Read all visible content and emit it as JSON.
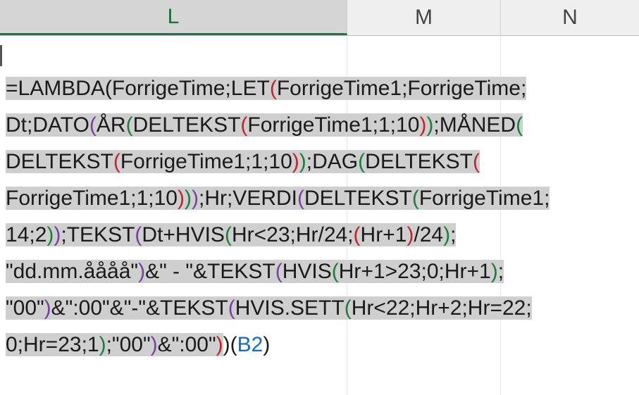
{
  "columns": [
    {
      "label": "L",
      "active": true
    },
    {
      "label": "M",
      "active": false
    },
    {
      "label": "N",
      "active": false
    }
  ],
  "formula": {
    "cell_reference_arg": "B2",
    "lines": [
      [
        {
          "t": "=LAMBDA(ForrigeTime;LET",
          "c": "text"
        },
        {
          "t": "(",
          "c": "red"
        },
        {
          "t": "ForrigeTime1;ForrigeTime;",
          "c": "text"
        }
      ],
      [
        {
          "t": "Dt;DATO",
          "c": "text"
        },
        {
          "t": "(",
          "c": "purple"
        },
        {
          "t": "ÅR",
          "c": "text"
        },
        {
          "t": "(",
          "c": "green"
        },
        {
          "t": "DELTEKST",
          "c": "text"
        },
        {
          "t": "(",
          "c": "red"
        },
        {
          "t": "ForrigeTime1;1;10",
          "c": "text"
        },
        {
          "t": ")",
          "c": "red"
        },
        {
          "t": ")",
          "c": "green"
        },
        {
          "t": ";MÅNED",
          "c": "text"
        },
        {
          "t": "(",
          "c": "green"
        }
      ],
      [
        {
          "t": "DELTEKST",
          "c": "text"
        },
        {
          "t": "(",
          "c": "red"
        },
        {
          "t": "ForrigeTime1;1;10",
          "c": "text"
        },
        {
          "t": ")",
          "c": "red"
        },
        {
          "t": ")",
          "c": "green"
        },
        {
          "t": ";DAG",
          "c": "text"
        },
        {
          "t": "(",
          "c": "green"
        },
        {
          "t": "DELTEKST",
          "c": "text"
        },
        {
          "t": "(",
          "c": "red"
        }
      ],
      [
        {
          "t": "ForrigeTime1;1;10",
          "c": "text"
        },
        {
          "t": ")",
          "c": "red"
        },
        {
          "t": ")",
          "c": "green"
        },
        {
          "t": ")",
          "c": "purple"
        },
        {
          "t": ";Hr;VERDI",
          "c": "text"
        },
        {
          "t": "(",
          "c": "purple"
        },
        {
          "t": "DELTEKST",
          "c": "text"
        },
        {
          "t": "(",
          "c": "green"
        },
        {
          "t": "ForrigeTime1;",
          "c": "text"
        }
      ],
      [
        {
          "t": "14;2",
          "c": "text"
        },
        {
          "t": ")",
          "c": "green"
        },
        {
          "t": ")",
          "c": "purple"
        },
        {
          "t": ";TEKST",
          "c": "text"
        },
        {
          "t": "(",
          "c": "purple"
        },
        {
          "t": "Dt+HVIS",
          "c": "text"
        },
        {
          "t": "(",
          "c": "green"
        },
        {
          "t": "Hr<23;Hr/24;",
          "c": "text"
        },
        {
          "t": "(",
          "c": "red"
        },
        {
          "t": "Hr+1",
          "c": "text"
        },
        {
          "t": ")",
          "c": "red"
        },
        {
          "t": "/24",
          "c": "text"
        },
        {
          "t": ")",
          "c": "green"
        },
        {
          "t": ";",
          "c": "text"
        }
      ],
      [
        {
          "t": "\"dd.mm.åååå\"",
          "c": "text"
        },
        {
          "t": ")",
          "c": "purple"
        },
        {
          "t": "&\" - \"&TEKST",
          "c": "text"
        },
        {
          "t": "(",
          "c": "purple"
        },
        {
          "t": "HVIS",
          "c": "text"
        },
        {
          "t": "(",
          "c": "green"
        },
        {
          "t": "Hr+1>23;0;Hr+1",
          "c": "text"
        },
        {
          "t": ")",
          "c": "green"
        },
        {
          "t": ";",
          "c": "text"
        }
      ],
      [
        {
          "t": "\"00\"",
          "c": "text"
        },
        {
          "t": ")",
          "c": "purple"
        },
        {
          "t": "&\":00\"&\"-\"&TEKST",
          "c": "text"
        },
        {
          "t": "(",
          "c": "purple"
        },
        {
          "t": "HVIS.SETT",
          "c": "text"
        },
        {
          "t": "(",
          "c": "green"
        },
        {
          "t": "Hr<22;Hr+2;Hr=22;",
          "c": "text"
        }
      ],
      [
        {
          "t": "0;Hr=23;1",
          "c": "text"
        },
        {
          "t": ")",
          "c": "green"
        },
        {
          "t": ";\"00\"",
          "c": "text"
        },
        {
          "t": ")",
          "c": "purple"
        },
        {
          "t": "&\":00\"",
          "c": "text"
        },
        {
          "t": ")",
          "c": "red"
        },
        {
          "t": ")",
          "c": "text",
          "unhl": true
        },
        {
          "t": "(",
          "c": "text",
          "unhl": true
        },
        {
          "t": "B2",
          "c": "blue",
          "unhl": true
        },
        {
          "t": ")",
          "c": "text",
          "unhl": true
        }
      ]
    ]
  }
}
